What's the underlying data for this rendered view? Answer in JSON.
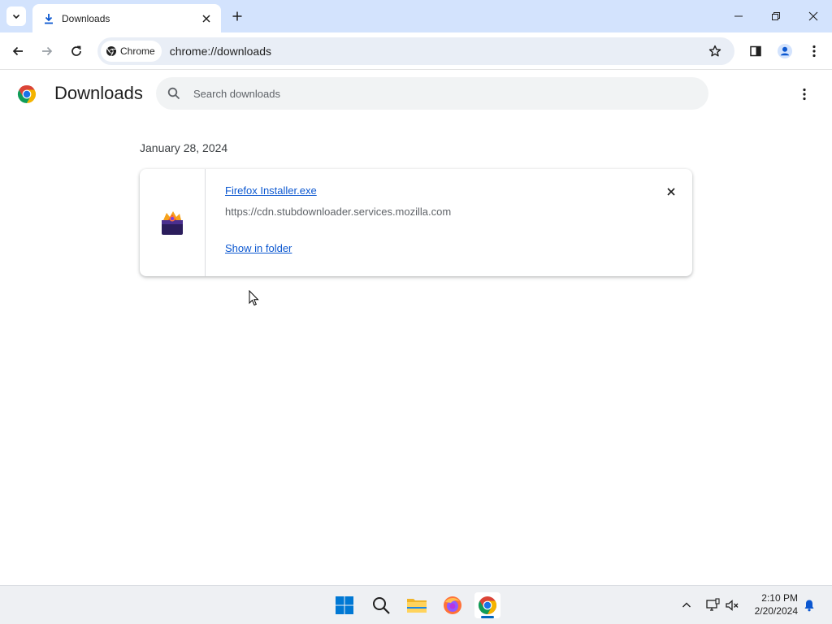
{
  "browser": {
    "tab": {
      "title": "Downloads"
    },
    "omnibox": {
      "chip_label": "Chrome",
      "url": "chrome://downloads"
    }
  },
  "downloads_page": {
    "title": "Downloads",
    "search": {
      "placeholder": "Search downloads",
      "value": ""
    },
    "groups": [
      {
        "date": "January 28, 2024",
        "items": [
          {
            "file_name": "Firefox Installer.exe",
            "source_url": "https://cdn.stubdownloader.services.mozilla.com",
            "action_label": "Show in folder"
          }
        ]
      }
    ]
  },
  "taskbar": {
    "apps": [
      "start-icon",
      "search-icon",
      "file-explorer-icon",
      "firefox-icon",
      "chrome-icon"
    ],
    "time": "2:10 PM",
    "date": "2/20/2024"
  },
  "colors": {
    "tab_strip": "#d3e3fd",
    "omnibox": "#e9eef6",
    "link": "#0b57d0",
    "taskbar": "#eef0f3"
  }
}
